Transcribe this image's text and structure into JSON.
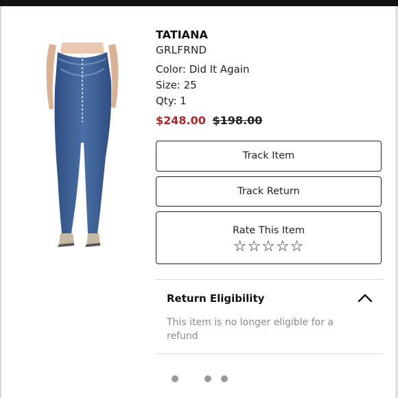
{
  "product": {
    "brand": "TATIANA",
    "designer": "GRLFRND",
    "color": "Color: Did It Again",
    "size": "Size: 25",
    "qty": "Qty: 1",
    "price_sale": "$248.00",
    "price_original": "$198.00",
    "image_icon": "jeans-product-photo"
  },
  "actions": {
    "track_item": "Track Item",
    "track_return": "Track Return",
    "rate_label": "Rate This Item",
    "stars": "☆☆☆☆☆"
  },
  "eligibility": {
    "title": "Return Eligibility",
    "message": "This item is no longer eligible for a refund",
    "expanded": true
  },
  "pagination": {
    "dots": 3
  },
  "colors": {
    "sale_price": "#a52a2a",
    "denim": "#3d5f93",
    "muted_text": "#8a8a8a"
  }
}
